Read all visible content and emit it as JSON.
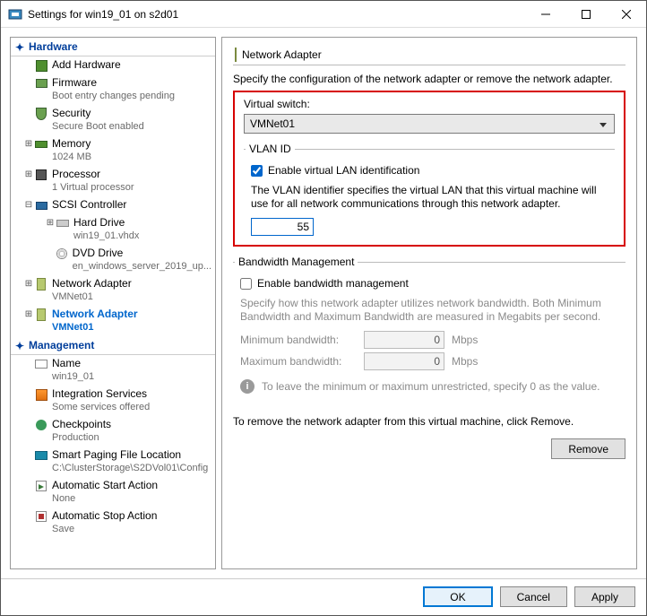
{
  "window": {
    "title": "Settings for win19_01 on s2d01"
  },
  "sections": {
    "hardware": "Hardware",
    "management": "Management"
  },
  "sidebar": {
    "addHardware": "Add Hardware",
    "firmware": {
      "label": "Firmware",
      "sub": "Boot entry changes pending"
    },
    "security": {
      "label": "Security",
      "sub": "Secure Boot enabled"
    },
    "memory": {
      "label": "Memory",
      "sub": "1024 MB"
    },
    "processor": {
      "label": "Processor",
      "sub": "1 Virtual processor"
    },
    "scsi": {
      "label": "SCSI Controller"
    },
    "hd": {
      "label": "Hard Drive",
      "sub": "win19_01.vhdx"
    },
    "dvd": {
      "label": "DVD Drive",
      "sub": "en_windows_server_2019_up..."
    },
    "nic1": {
      "label": "Network Adapter",
      "sub": "VMNet01"
    },
    "nic2": {
      "label": "Network Adapter",
      "sub": "VMNet01"
    },
    "name": {
      "label": "Name",
      "sub": "win19_01"
    },
    "integration": {
      "label": "Integration Services",
      "sub": "Some services offered"
    },
    "checkpoints": {
      "label": "Checkpoints",
      "sub": "Production"
    },
    "smart": {
      "label": "Smart Paging File Location",
      "sub": "C:\\ClusterStorage\\S2DVol01\\Config"
    },
    "autostart": {
      "label": "Automatic Start Action",
      "sub": "None"
    },
    "autostop": {
      "label": "Automatic Stop Action",
      "sub": "Save"
    }
  },
  "pane": {
    "title": "Network Adapter",
    "desc": "Specify the configuration of the network adapter or remove the network adapter.",
    "vswitchLabel": "Virtual switch:",
    "vswitchValue": "VMNet01",
    "vlanGroup": "VLAN ID",
    "vlanEnable": "Enable virtual LAN identification",
    "vlanHelp": "The VLAN identifier specifies the virtual LAN that this virtual machine will use for all network communications through this network adapter.",
    "vlanId": "55",
    "bwGroup": "Bandwidth Management",
    "bwEnable": "Enable bandwidth management",
    "bwHelp": "Specify how this network adapter utilizes network bandwidth. Both Minimum Bandwidth and Maximum Bandwidth are measured in Megabits per second.",
    "bwMinLabel": "Minimum bandwidth:",
    "bwMaxLabel": "Maximum bandwidth:",
    "bwMin": "0",
    "bwMax": "0",
    "bwUnit": "Mbps",
    "bwInfo": "To leave the minimum or maximum unrestricted, specify 0 as the value.",
    "removeText": "To remove the network adapter from this virtual machine, click Remove.",
    "removeBtn": "Remove"
  },
  "buttons": {
    "ok": "OK",
    "cancel": "Cancel",
    "apply": "Apply"
  }
}
